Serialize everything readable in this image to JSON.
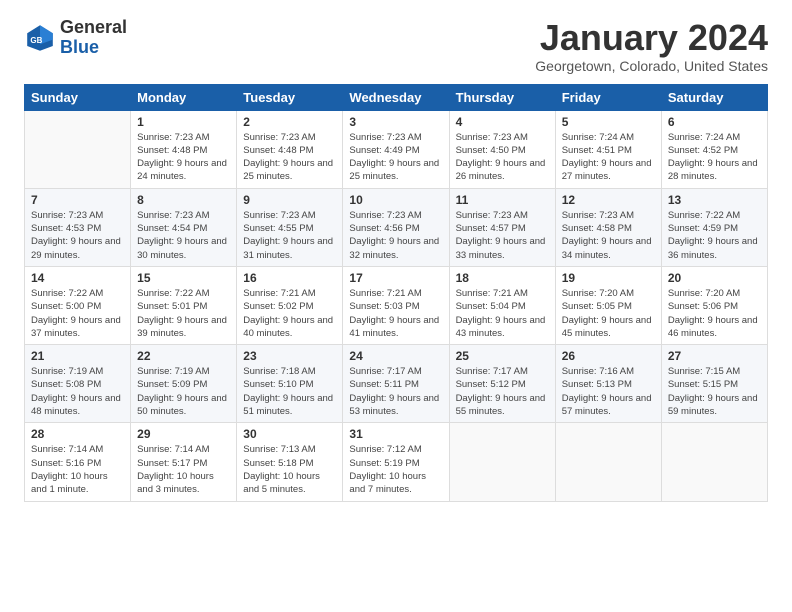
{
  "header": {
    "logo_general": "General",
    "logo_blue": "Blue",
    "month_title": "January 2024",
    "location": "Georgetown, Colorado, United States"
  },
  "days_of_week": [
    "Sunday",
    "Monday",
    "Tuesday",
    "Wednesday",
    "Thursday",
    "Friday",
    "Saturday"
  ],
  "weeks": [
    [
      {
        "day": "",
        "sunrise": "",
        "sunset": "",
        "daylight": ""
      },
      {
        "day": "1",
        "sunrise": "Sunrise: 7:23 AM",
        "sunset": "Sunset: 4:48 PM",
        "daylight": "Daylight: 9 hours and 24 minutes."
      },
      {
        "day": "2",
        "sunrise": "Sunrise: 7:23 AM",
        "sunset": "Sunset: 4:48 PM",
        "daylight": "Daylight: 9 hours and 25 minutes."
      },
      {
        "day": "3",
        "sunrise": "Sunrise: 7:23 AM",
        "sunset": "Sunset: 4:49 PM",
        "daylight": "Daylight: 9 hours and 25 minutes."
      },
      {
        "day": "4",
        "sunrise": "Sunrise: 7:23 AM",
        "sunset": "Sunset: 4:50 PM",
        "daylight": "Daylight: 9 hours and 26 minutes."
      },
      {
        "day": "5",
        "sunrise": "Sunrise: 7:24 AM",
        "sunset": "Sunset: 4:51 PM",
        "daylight": "Daylight: 9 hours and 27 minutes."
      },
      {
        "day": "6",
        "sunrise": "Sunrise: 7:24 AM",
        "sunset": "Sunset: 4:52 PM",
        "daylight": "Daylight: 9 hours and 28 minutes."
      }
    ],
    [
      {
        "day": "7",
        "sunrise": "Sunrise: 7:23 AM",
        "sunset": "Sunset: 4:53 PM",
        "daylight": "Daylight: 9 hours and 29 minutes."
      },
      {
        "day": "8",
        "sunrise": "Sunrise: 7:23 AM",
        "sunset": "Sunset: 4:54 PM",
        "daylight": "Daylight: 9 hours and 30 minutes."
      },
      {
        "day": "9",
        "sunrise": "Sunrise: 7:23 AM",
        "sunset": "Sunset: 4:55 PM",
        "daylight": "Daylight: 9 hours and 31 minutes."
      },
      {
        "day": "10",
        "sunrise": "Sunrise: 7:23 AM",
        "sunset": "Sunset: 4:56 PM",
        "daylight": "Daylight: 9 hours and 32 minutes."
      },
      {
        "day": "11",
        "sunrise": "Sunrise: 7:23 AM",
        "sunset": "Sunset: 4:57 PM",
        "daylight": "Daylight: 9 hours and 33 minutes."
      },
      {
        "day": "12",
        "sunrise": "Sunrise: 7:23 AM",
        "sunset": "Sunset: 4:58 PM",
        "daylight": "Daylight: 9 hours and 34 minutes."
      },
      {
        "day": "13",
        "sunrise": "Sunrise: 7:22 AM",
        "sunset": "Sunset: 4:59 PM",
        "daylight": "Daylight: 9 hours and 36 minutes."
      }
    ],
    [
      {
        "day": "14",
        "sunrise": "Sunrise: 7:22 AM",
        "sunset": "Sunset: 5:00 PM",
        "daylight": "Daylight: 9 hours and 37 minutes."
      },
      {
        "day": "15",
        "sunrise": "Sunrise: 7:22 AM",
        "sunset": "Sunset: 5:01 PM",
        "daylight": "Daylight: 9 hours and 39 minutes."
      },
      {
        "day": "16",
        "sunrise": "Sunrise: 7:21 AM",
        "sunset": "Sunset: 5:02 PM",
        "daylight": "Daylight: 9 hours and 40 minutes."
      },
      {
        "day": "17",
        "sunrise": "Sunrise: 7:21 AM",
        "sunset": "Sunset: 5:03 PM",
        "daylight": "Daylight: 9 hours and 41 minutes."
      },
      {
        "day": "18",
        "sunrise": "Sunrise: 7:21 AM",
        "sunset": "Sunset: 5:04 PM",
        "daylight": "Daylight: 9 hours and 43 minutes."
      },
      {
        "day": "19",
        "sunrise": "Sunrise: 7:20 AM",
        "sunset": "Sunset: 5:05 PM",
        "daylight": "Daylight: 9 hours and 45 minutes."
      },
      {
        "day": "20",
        "sunrise": "Sunrise: 7:20 AM",
        "sunset": "Sunset: 5:06 PM",
        "daylight": "Daylight: 9 hours and 46 minutes."
      }
    ],
    [
      {
        "day": "21",
        "sunrise": "Sunrise: 7:19 AM",
        "sunset": "Sunset: 5:08 PM",
        "daylight": "Daylight: 9 hours and 48 minutes."
      },
      {
        "day": "22",
        "sunrise": "Sunrise: 7:19 AM",
        "sunset": "Sunset: 5:09 PM",
        "daylight": "Daylight: 9 hours and 50 minutes."
      },
      {
        "day": "23",
        "sunrise": "Sunrise: 7:18 AM",
        "sunset": "Sunset: 5:10 PM",
        "daylight": "Daylight: 9 hours and 51 minutes."
      },
      {
        "day": "24",
        "sunrise": "Sunrise: 7:17 AM",
        "sunset": "Sunset: 5:11 PM",
        "daylight": "Daylight: 9 hours and 53 minutes."
      },
      {
        "day": "25",
        "sunrise": "Sunrise: 7:17 AM",
        "sunset": "Sunset: 5:12 PM",
        "daylight": "Daylight: 9 hours and 55 minutes."
      },
      {
        "day": "26",
        "sunrise": "Sunrise: 7:16 AM",
        "sunset": "Sunset: 5:13 PM",
        "daylight": "Daylight: 9 hours and 57 minutes."
      },
      {
        "day": "27",
        "sunrise": "Sunrise: 7:15 AM",
        "sunset": "Sunset: 5:15 PM",
        "daylight": "Daylight: 9 hours and 59 minutes."
      }
    ],
    [
      {
        "day": "28",
        "sunrise": "Sunrise: 7:14 AM",
        "sunset": "Sunset: 5:16 PM",
        "daylight": "Daylight: 10 hours and 1 minute."
      },
      {
        "day": "29",
        "sunrise": "Sunrise: 7:14 AM",
        "sunset": "Sunset: 5:17 PM",
        "daylight": "Daylight: 10 hours and 3 minutes."
      },
      {
        "day": "30",
        "sunrise": "Sunrise: 7:13 AM",
        "sunset": "Sunset: 5:18 PM",
        "daylight": "Daylight: 10 hours and 5 minutes."
      },
      {
        "day": "31",
        "sunrise": "Sunrise: 7:12 AM",
        "sunset": "Sunset: 5:19 PM",
        "daylight": "Daylight: 10 hours and 7 minutes."
      },
      {
        "day": "",
        "sunrise": "",
        "sunset": "",
        "daylight": ""
      },
      {
        "day": "",
        "sunrise": "",
        "sunset": "",
        "daylight": ""
      },
      {
        "day": "",
        "sunrise": "",
        "sunset": "",
        "daylight": ""
      }
    ]
  ]
}
